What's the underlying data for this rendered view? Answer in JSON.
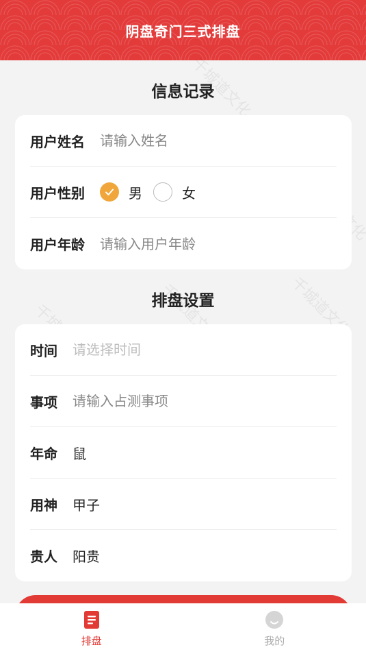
{
  "header": {
    "title": "阴盘奇门三式排盘"
  },
  "watermark": "千城道文化",
  "info_section": {
    "title": "信息记录",
    "name": {
      "label": "用户姓名",
      "placeholder": "请输入姓名"
    },
    "gender": {
      "label": "用户性别",
      "options": [
        {
          "label": "男",
          "checked": true
        },
        {
          "label": "女",
          "checked": false
        }
      ]
    },
    "age": {
      "label": "用户年龄",
      "placeholder": "请输入用户年龄"
    }
  },
  "setting_section": {
    "title": "排盘设置",
    "time": {
      "label": "时间",
      "placeholder": "请选择时间"
    },
    "matter": {
      "label": "事项",
      "placeholder": "请输入占测事项"
    },
    "nianming": {
      "label": "年命",
      "value": "鼠"
    },
    "yongshen": {
      "label": "用神",
      "value": "甲子"
    },
    "guiren": {
      "label": "贵人",
      "value": "阳贵"
    }
  },
  "tabbar": {
    "tabs": [
      {
        "label": "排盘",
        "icon": "document-icon",
        "active": true
      },
      {
        "label": "我的",
        "icon": "profile-icon",
        "active": false
      }
    ]
  },
  "colors": {
    "primary": "#e23b36",
    "radio_checked": "#f0a63a"
  }
}
